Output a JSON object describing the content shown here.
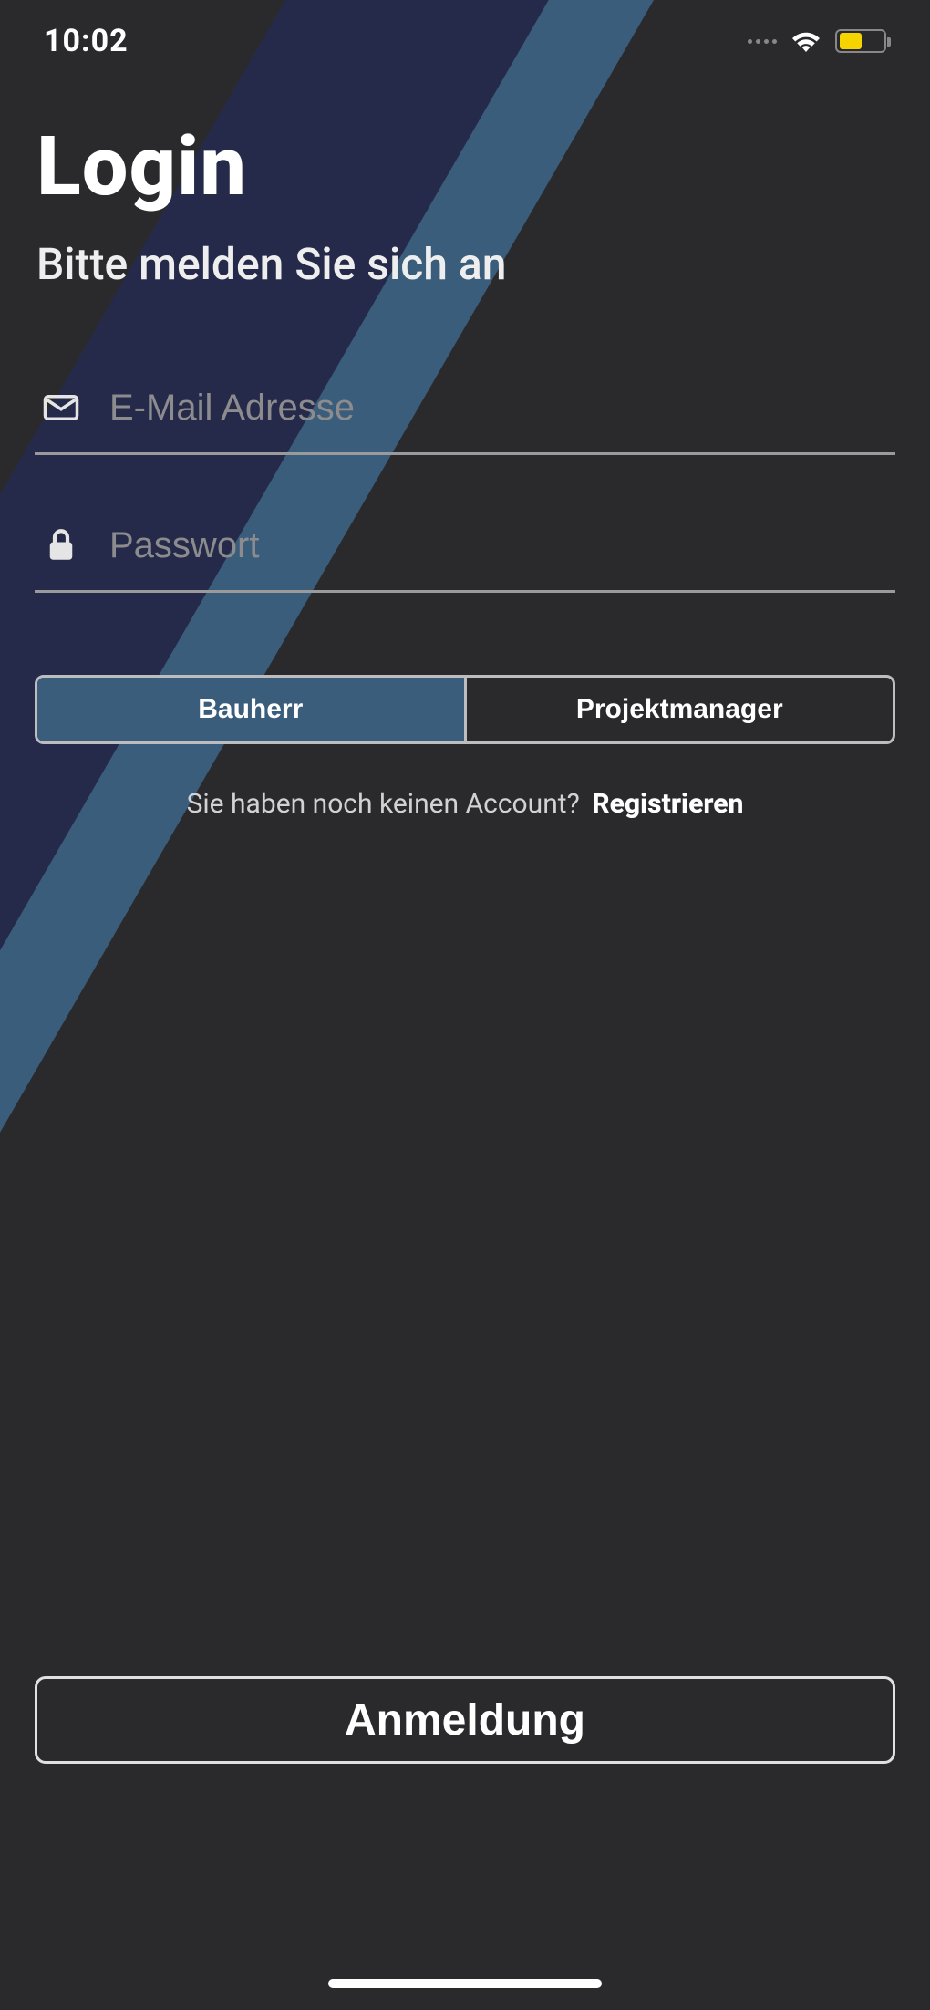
{
  "status": {
    "time": "10:02"
  },
  "header": {
    "title": "Login",
    "subtitle": "Bitte melden Sie sich an"
  },
  "form": {
    "email": {
      "placeholder": "E-Mail Adresse",
      "value": ""
    },
    "password": {
      "placeholder": "Passwort",
      "value": ""
    }
  },
  "segmented": {
    "option_a": "Bauherr",
    "option_b": "Projektmanager",
    "selected": "Bauherr"
  },
  "register": {
    "prompt": "Sie haben noch keinen Account?",
    "link": "Registrieren"
  },
  "submit": {
    "label": "Anmeldung"
  }
}
